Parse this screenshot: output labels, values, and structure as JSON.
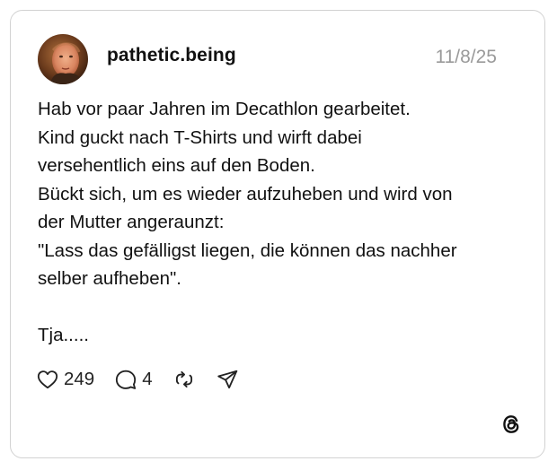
{
  "post": {
    "username": "pathetic.being",
    "date": "11/8/25",
    "lines": [
      "Hab vor paar Jahren im Decathlon gearbeitet.",
      "Kind guckt nach T-Shirts und wirft dabei",
      "versehentlich eins auf den Boden.",
      "Bückt sich, um es wieder aufzuheben und wird von",
      "der Mutter angeraunzt:",
      "\"Lass das gefälligst liegen, die können das nachher",
      "selber aufheben\".",
      "",
      "Tja....."
    ],
    "likes": "249",
    "replies": "4"
  },
  "icons": {
    "like": "heart-icon",
    "reply": "comment-bubble-icon",
    "repost": "repost-icon",
    "share": "send-icon",
    "brand": "threads-logo-icon"
  },
  "colors": {
    "text": "#111111",
    "date": "#9a9a9a",
    "border": "#d2d2d2"
  }
}
